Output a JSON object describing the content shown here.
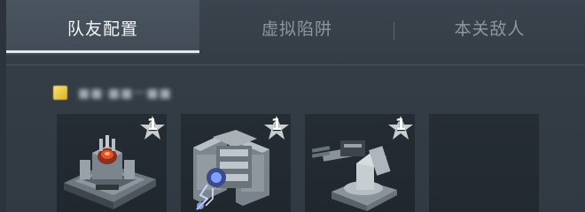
{
  "tabs": [
    {
      "label": "队友配置",
      "active": true
    },
    {
      "label": "虚拟陷阱",
      "active": false
    },
    {
      "label": "本关敌人",
      "active": false
    }
  ],
  "player": {
    "badge_color": "#f2cf45",
    "name": "■■·■■一■■"
  },
  "slots": [
    {
      "unit": "core-reactor-turret",
      "level": "1"
    },
    {
      "unit": "tesla-shield-turret",
      "level": "1"
    },
    {
      "unit": "gatling-cannon-turret",
      "level": "1"
    },
    {
      "unit": "empty-slot",
      "level": ""
    }
  ],
  "colors": {
    "active_tab_bg": "#48525c",
    "active_underline": "#dfe7ec",
    "inactive_text": "#8c969f",
    "star": "#c9ced2"
  }
}
